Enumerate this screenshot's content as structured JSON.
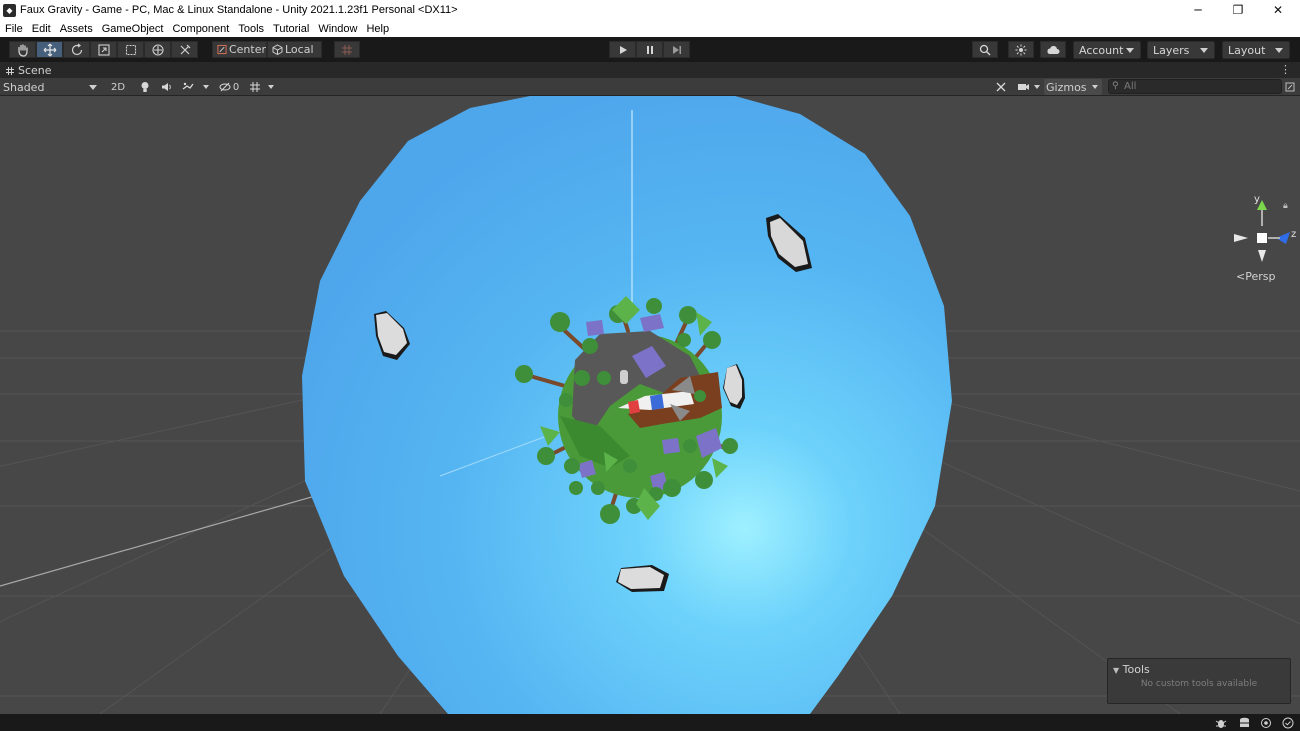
{
  "window": {
    "title": "Faux Gravity - Game - PC, Mac & Linux Standalone - Unity 2021.1.23f1 Personal <DX11>",
    "controls": {
      "minimize": "─",
      "maximize": "❐",
      "close": "✕"
    }
  },
  "menu": [
    "File",
    "Edit",
    "Assets",
    "GameObject",
    "Component",
    "Tools",
    "Tutorial",
    "Window",
    "Help"
  ],
  "toolbar": {
    "transform_tools": [
      "hand-icon",
      "move-icon",
      "rotate-icon",
      "scale-icon",
      "rect-icon",
      "transform-icon",
      "custom-tool-icon"
    ],
    "active_tool": "move-icon",
    "pivot_mode": "Center",
    "pivot_rotation": "Local",
    "snap_icon": "grid-snap-icon",
    "play_controls": [
      "play-icon",
      "pause-icon",
      "step-icon"
    ],
    "account_label": "Account",
    "layers_label": "Layers",
    "layout_label": "Layout"
  },
  "scene_tab": {
    "label": "Scene"
  },
  "scene_toolbar": {
    "draw_mode": "Shaded",
    "toggle_2d": "2D",
    "hidden_count": "0",
    "gizmos_label": "Gizmos",
    "search_placeholder": "All"
  },
  "orientation_gizmo": {
    "y": "y",
    "z": "z",
    "projection": "Persp"
  },
  "tools_overlay": {
    "title": "Tools",
    "message": "No custom tools available"
  },
  "colors": {
    "editor_background": "#474747",
    "toolbar_background": "#191919",
    "sky_sphere": "#5ab8f4",
    "planet_grass": "#4b9a39",
    "tree_green": "#3f8f3a",
    "rock": "#d9d9d9",
    "active_tool": "#46607c"
  }
}
